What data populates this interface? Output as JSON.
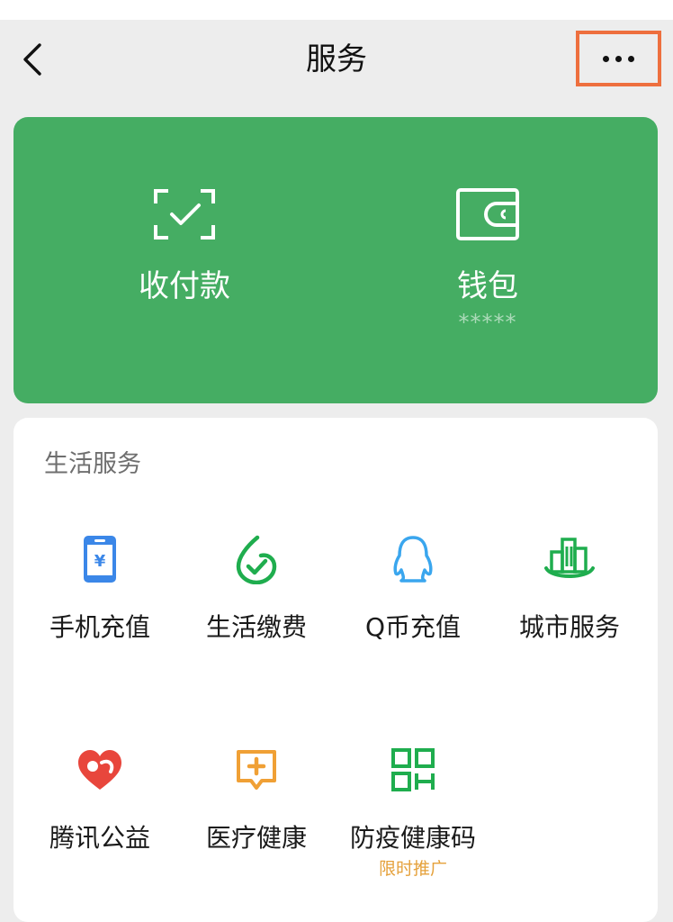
{
  "nav": {
    "title": "服务"
  },
  "wallet_card": {
    "pay_label": "收付款",
    "wallet_label": "钱包",
    "wallet_balance": "*****"
  },
  "life_services": {
    "title": "生活服务",
    "items": [
      {
        "label": "手机充值",
        "icon": "phone-recharge-icon",
        "color": "#3b87e8"
      },
      {
        "label": "生活缴费",
        "icon": "bill-payment-icon",
        "color": "#1fad4e"
      },
      {
        "label": "Q币充值",
        "icon": "qq-penguin-icon",
        "color": "#3aa6ee"
      },
      {
        "label": "城市服务",
        "icon": "city-buildings-icon",
        "color": "#1fad4e"
      },
      {
        "label": "腾讯公益",
        "icon": "charity-heart-icon",
        "color": "#e8463c"
      },
      {
        "label": "医疗健康",
        "icon": "medical-chat-icon",
        "color": "#f0a035"
      },
      {
        "label": "防疫健康码",
        "icon": "qr-code-icon",
        "color": "#1fad4e",
        "badge": "限时推广"
      }
    ]
  },
  "colors": {
    "background": "#ededed",
    "card_green": "#45ad63",
    "highlight_border": "#ee6f3e",
    "promo_text": "#e5a13b"
  }
}
